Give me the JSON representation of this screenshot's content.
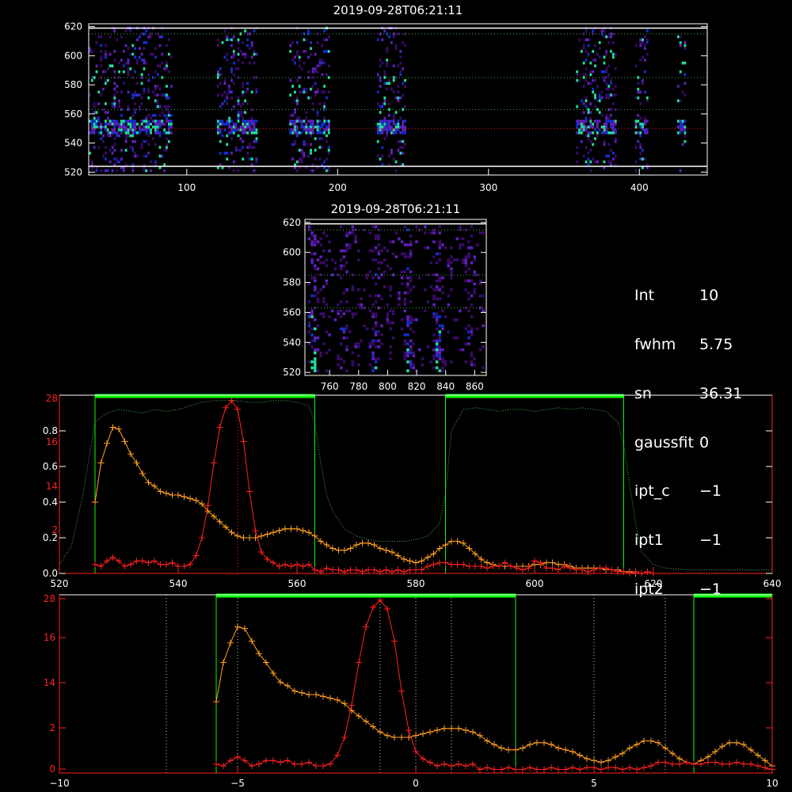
{
  "colors": {
    "background": "#000000",
    "frame": "#ffffff",
    "green_band": "#00ff00",
    "green_dotted": "#4caf50",
    "orange": "#ffa020",
    "red": "#ff2020",
    "spec_low": "#3a0a6a",
    "spec_mid": "#1030d0",
    "spec_high": "#20e0a0"
  },
  "readout": [
    {
      "key": "Int",
      "value": "10"
    },
    {
      "key": "fwhm",
      "value": "5.75"
    },
    {
      "key": "sn",
      "value": "36.31"
    },
    {
      "key": "gaussfit",
      "value": "0"
    },
    {
      "key": "ipt_c",
      "value": "−1"
    },
    {
      "key": "ipt1",
      "value": "−1"
    },
    {
      "key": "ipt2",
      "value": "−1"
    }
  ],
  "chart_data": [
    {
      "type": "heatmap",
      "title": "2019-09-28T06:21:11",
      "xlim": [
        35,
        445
      ],
      "ylim": [
        518,
        622
      ],
      "xticks": [
        "100",
        "200",
        "300",
        "400"
      ],
      "yticks": [
        "520",
        "540",
        "560",
        "580",
        "600",
        "620"
      ],
      "ref_lines": {
        "white": [
          524,
          619
        ],
        "green": [
          563,
          585,
          615
        ],
        "red": [
          550
        ]
      },
      "bands": [
        [
          35,
          90
        ],
        [
          120,
          147
        ],
        [
          168,
          195
        ],
        [
          226,
          245
        ],
        [
          358,
          385
        ],
        [
          397,
          405
        ],
        [
          425,
          430
        ]
      ],
      "line_center": 550
    },
    {
      "type": "heatmap",
      "title": "2019-09-28T06:21:11",
      "xlim": [
        743,
        868
      ],
      "ylim": [
        518,
        622
      ],
      "xticks": [
        "760",
        "780",
        "800",
        "820",
        "840",
        "860"
      ],
      "yticks": [
        "520",
        "540",
        "560",
        "580",
        "600",
        "620"
      ],
      "ref_lines": {
        "white": [
          619
        ],
        "green": [
          563,
          585,
          615
        ]
      },
      "streaks": [
        [
          748,
          0.9
        ],
        [
          768,
          0.5
        ],
        [
          791,
          0.6
        ],
        [
          813,
          0.8
        ],
        [
          834,
          1.0
        ],
        [
          856,
          0.5
        ]
      ]
    },
    {
      "type": "line",
      "xlim": [
        520,
        640
      ],
      "ylim": [
        0,
        1.0
      ],
      "xticks": [
        "520",
        "540",
        "560",
        "580",
        "600",
        "620",
        "640"
      ],
      "yticks": [
        "0.0",
        "0.2",
        "0.4",
        "0.6",
        "0.8"
      ],
      "yticks_red": [
        "2",
        "14",
        "16",
        "28"
      ],
      "green_bands": [
        [
          526,
          563
        ],
        [
          585,
          615
        ]
      ],
      "center_line": 550,
      "series": [
        {
          "color": "orange",
          "x": [
            526,
            527,
            528,
            529,
            530,
            531,
            532,
            533,
            534,
            535,
            536,
            537,
            538,
            539,
            540,
            541,
            542,
            543,
            544,
            545,
            546,
            547,
            548,
            549,
            550,
            551,
            552,
            553,
            554,
            555,
            556,
            557,
            558,
            559,
            560,
            561,
            562,
            563,
            564,
            565,
            566,
            567,
            568,
            569,
            570,
            571,
            572,
            573,
            574,
            575,
            576,
            577,
            578,
            579,
            580,
            581,
            582,
            583,
            584,
            585,
            586,
            587,
            588,
            589,
            590,
            591,
            592,
            593,
            594,
            595,
            596,
            597,
            598,
            599,
            600,
            601,
            602,
            603,
            604,
            605,
            606,
            607,
            608,
            609,
            610,
            611,
            612,
            613,
            614,
            615,
            616,
            617,
            618
          ],
          "y": [
            0.4,
            0.62,
            0.73,
            0.82,
            0.81,
            0.74,
            0.67,
            0.62,
            0.56,
            0.51,
            0.49,
            0.46,
            0.45,
            0.44,
            0.44,
            0.43,
            0.42,
            0.41,
            0.39,
            0.35,
            0.32,
            0.29,
            0.26,
            0.23,
            0.21,
            0.2,
            0.2,
            0.2,
            0.21,
            0.22,
            0.23,
            0.24,
            0.25,
            0.25,
            0.25,
            0.24,
            0.23,
            0.21,
            0.18,
            0.16,
            0.14,
            0.13,
            0.13,
            0.14,
            0.16,
            0.17,
            0.17,
            0.16,
            0.14,
            0.13,
            0.12,
            0.1,
            0.08,
            0.07,
            0.06,
            0.07,
            0.09,
            0.11,
            0.14,
            0.16,
            0.18,
            0.18,
            0.17,
            0.14,
            0.11,
            0.08,
            0.06,
            0.05,
            0.04,
            0.04,
            0.04,
            0.04,
            0.04,
            0.04,
            0.05,
            0.05,
            0.06,
            0.06,
            0.05,
            0.05,
            0.04,
            0.03,
            0.03,
            0.03,
            0.03,
            0.03,
            0.02,
            0.02,
            0.02,
            0.01,
            0.01,
            0.0,
            0.0
          ]
        },
        {
          "color": "red",
          "x": [
            526,
            527,
            528,
            529,
            530,
            531,
            532,
            533,
            534,
            535,
            536,
            537,
            538,
            539,
            540,
            541,
            542,
            543,
            544,
            545,
            546,
            547,
            548,
            549,
            550,
            551,
            552,
            553,
            554,
            555,
            556,
            557,
            558,
            559,
            560,
            561,
            562,
            563,
            564,
            565,
            566,
            567,
            568,
            569,
            570,
            571,
            572,
            573,
            574,
            575,
            576,
            577,
            578,
            579,
            580,
            581,
            582,
            583,
            584,
            585,
            586,
            587,
            588,
            589,
            590,
            591,
            592,
            593,
            594,
            595,
            596,
            597,
            598,
            599,
            600,
            601,
            602,
            603,
            604,
            605,
            606,
            607,
            608,
            609,
            610,
            611,
            612,
            613,
            614,
            615,
            616,
            617,
            618,
            619,
            620
          ],
          "y": [
            0.05,
            0.04,
            0.07,
            0.09,
            0.07,
            0.04,
            0.05,
            0.07,
            0.07,
            0.06,
            0.07,
            0.05,
            0.05,
            0.06,
            0.04,
            0.04,
            0.05,
            0.1,
            0.2,
            0.38,
            0.62,
            0.82,
            0.93,
            0.97,
            0.92,
            0.74,
            0.46,
            0.24,
            0.12,
            0.08,
            0.06,
            0.04,
            0.05,
            0.04,
            0.05,
            0.04,
            0.05,
            0.02,
            0.01,
            0.03,
            0.02,
            0.02,
            0.01,
            0.02,
            0.02,
            0.01,
            0.02,
            0.02,
            0.01,
            0.02,
            0.01,
            0.02,
            0.01,
            0.02,
            0.02,
            0.02,
            0.04,
            0.05,
            0.06,
            0.06,
            0.05,
            0.05,
            0.05,
            0.04,
            0.04,
            0.04,
            0.03,
            0.04,
            0.04,
            0.06,
            0.04,
            0.03,
            0.02,
            0.03,
            0.07,
            0.06,
            0.03,
            0.03,
            0.02,
            0.04,
            0.03,
            0.02,
            0.02,
            0.01,
            0.02,
            0.03,
            0.03,
            0.02,
            0.01,
            0.01,
            0.0,
            0.01,
            0.0,
            0.01,
            0.0
          ]
        },
        {
          "color": "green_dotted",
          "x": [
            520,
            522,
            524,
            526,
            528,
            530,
            532,
            534,
            536,
            538,
            540,
            542,
            544,
            546,
            548,
            550,
            552,
            554,
            556,
            558,
            560,
            562,
            563,
            564,
            565,
            566,
            568,
            570,
            572,
            574,
            576,
            578,
            580,
            582,
            584,
            585,
            586,
            588,
            590,
            592,
            594,
            596,
            598,
            600,
            602,
            604,
            606,
            608,
            610,
            612,
            614,
            615,
            616,
            617,
            618,
            620,
            622,
            626,
            630,
            634,
            640
          ],
          "y": [
            0.05,
            0.15,
            0.45,
            0.85,
            0.9,
            0.92,
            0.91,
            0.9,
            0.92,
            0.91,
            0.92,
            0.94,
            0.96,
            0.97,
            0.97,
            0.97,
            0.96,
            0.96,
            0.97,
            0.97,
            0.96,
            0.94,
            0.85,
            0.62,
            0.44,
            0.35,
            0.25,
            0.21,
            0.19,
            0.18,
            0.18,
            0.18,
            0.19,
            0.21,
            0.28,
            0.45,
            0.8,
            0.92,
            0.93,
            0.92,
            0.91,
            0.92,
            0.92,
            0.91,
            0.92,
            0.93,
            0.92,
            0.93,
            0.92,
            0.91,
            0.85,
            0.72,
            0.5,
            0.28,
            0.12,
            0.05,
            0.03,
            0.02,
            0.02,
            0.02,
            0.02
          ]
        }
      ]
    },
    {
      "type": "line",
      "xlim": [
        -10,
        10
      ],
      "ylim": [
        0,
        1.0
      ],
      "xticks": [
        "−10",
        "−5",
        "0",
        "5",
        "10"
      ],
      "yticks_red": [
        "0",
        "2",
        "14",
        "16",
        "28"
      ],
      "green_bands": [
        [
          -5.6,
          2.8
        ],
        [
          7.8,
          10
        ]
      ],
      "dotted_x": [
        -7,
        -5,
        -1,
        0,
        1,
        5,
        7
      ],
      "series": [
        {
          "color": "orange",
          "x": [
            -5.6,
            -5.4,
            -5.2,
            -5.0,
            -4.8,
            -4.6,
            -4.4,
            -4.2,
            -4.0,
            -3.8,
            -3.6,
            -3.4,
            -3.2,
            -3.0,
            -2.8,
            -2.6,
            -2.4,
            -2.2,
            -2.0,
            -1.8,
            -1.6,
            -1.4,
            -1.2,
            -1.0,
            -0.8,
            -0.6,
            -0.4,
            -0.2,
            0.0,
            0.2,
            0.4,
            0.6,
            0.8,
            1.0,
            1.2,
            1.4,
            1.6,
            1.8,
            2.0,
            2.2,
            2.4,
            2.6,
            2.8,
            3.0,
            3.2,
            3.4,
            3.6,
            3.8,
            4.0,
            4.2,
            4.4,
            4.6,
            4.8,
            5.0,
            5.2,
            5.4,
            5.6,
            5.8,
            6.0,
            6.2,
            6.4,
            6.6,
            6.8,
            7.0,
            7.2,
            7.4,
            7.6,
            7.8,
            8.0,
            8.2,
            8.4,
            8.6,
            8.8,
            9.0,
            9.2,
            9.4,
            9.6,
            9.8,
            10.0
          ],
          "y": [
            0.4,
            0.62,
            0.73,
            0.82,
            0.81,
            0.74,
            0.67,
            0.62,
            0.56,
            0.51,
            0.49,
            0.46,
            0.45,
            0.44,
            0.44,
            0.43,
            0.42,
            0.41,
            0.39,
            0.35,
            0.32,
            0.29,
            0.26,
            0.23,
            0.21,
            0.2,
            0.2,
            0.2,
            0.21,
            0.22,
            0.23,
            0.24,
            0.25,
            0.25,
            0.25,
            0.24,
            0.23,
            0.21,
            0.18,
            0.16,
            0.14,
            0.13,
            0.13,
            0.14,
            0.16,
            0.17,
            0.17,
            0.16,
            0.14,
            0.13,
            0.12,
            0.1,
            0.08,
            0.07,
            0.06,
            0.07,
            0.09,
            0.11,
            0.14,
            0.16,
            0.18,
            0.18,
            0.17,
            0.14,
            0.11,
            0.08,
            0.06,
            0.05,
            0.07,
            0.09,
            0.12,
            0.15,
            0.17,
            0.17,
            0.16,
            0.13,
            0.1,
            0.07,
            0.04
          ]
        },
        {
          "color": "red",
          "x": [
            -5.6,
            -5.4,
            -5.2,
            -5.0,
            -4.8,
            -4.6,
            -4.4,
            -4.2,
            -4.0,
            -3.8,
            -3.6,
            -3.4,
            -3.2,
            -3.0,
            -2.8,
            -2.6,
            -2.4,
            -2.2,
            -2.0,
            -1.8,
            -1.6,
            -1.4,
            -1.2,
            -1.0,
            -0.8,
            -0.6,
            -0.4,
            -0.2,
            0.0,
            0.2,
            0.4,
            0.6,
            0.8,
            1.0,
            1.2,
            1.4,
            1.6,
            1.8,
            2.0,
            2.2,
            2.4,
            2.6,
            2.8,
            3.0,
            3.2,
            3.4,
            3.6,
            3.8,
            4.0,
            4.2,
            4.4,
            4.6,
            4.8,
            5.0,
            5.2,
            5.4,
            5.6,
            5.8,
            6.0,
            6.2,
            6.4,
            6.6,
            6.8,
            7.0,
            7.2,
            7.4,
            7.6,
            7.8,
            8.0,
            8.2,
            8.4,
            8.6,
            8.8,
            9.0,
            9.2,
            9.4,
            9.6,
            9.8,
            10.0
          ],
          "y": [
            0.05,
            0.04,
            0.07,
            0.09,
            0.07,
            0.04,
            0.05,
            0.07,
            0.07,
            0.06,
            0.07,
            0.05,
            0.05,
            0.06,
            0.04,
            0.04,
            0.05,
            0.1,
            0.2,
            0.38,
            0.62,
            0.82,
            0.93,
            0.97,
            0.92,
            0.74,
            0.46,
            0.24,
            0.12,
            0.08,
            0.06,
            0.04,
            0.05,
            0.04,
            0.05,
            0.04,
            0.05,
            0.02,
            0.03,
            0.02,
            0.02,
            0.03,
            0.02,
            0.02,
            0.03,
            0.02,
            0.02,
            0.03,
            0.02,
            0.02,
            0.03,
            0.02,
            0.03,
            0.03,
            0.02,
            0.03,
            0.03,
            0.02,
            0.03,
            0.02,
            0.03,
            0.04,
            0.06,
            0.06,
            0.05,
            0.05,
            0.06,
            0.05,
            0.05,
            0.06,
            0.06,
            0.05,
            0.05,
            0.06,
            0.05,
            0.05,
            0.04,
            0.03,
            0.02
          ]
        }
      ]
    }
  ]
}
